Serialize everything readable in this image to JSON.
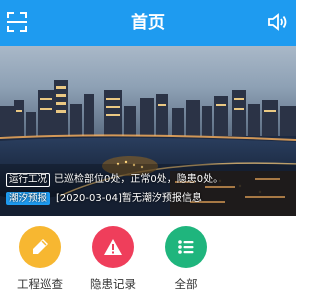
{
  "header": {
    "title": "首页",
    "left_icon": "scan-icon",
    "right_icon": "volume-icon",
    "color": "#1e9bf0"
  },
  "banner": {
    "image": "city-night-river-photo",
    "notice": {
      "tag": "运行工况",
      "text": "已巡检部位0处，正常0处，隐患0处。"
    },
    "tide": {
      "tag": "潮汐预报",
      "text": "[2020-03-04]暂无潮汐预报信息"
    }
  },
  "actions": [
    {
      "label": "工程巡查",
      "icon": "pencil-icon",
      "color": "#f7b731"
    },
    {
      "label": "隐患记录",
      "icon": "warning-icon",
      "color": "#ef3e5b"
    },
    {
      "label": "全部",
      "icon": "list-icon",
      "color": "#1fb57d"
    }
  ]
}
